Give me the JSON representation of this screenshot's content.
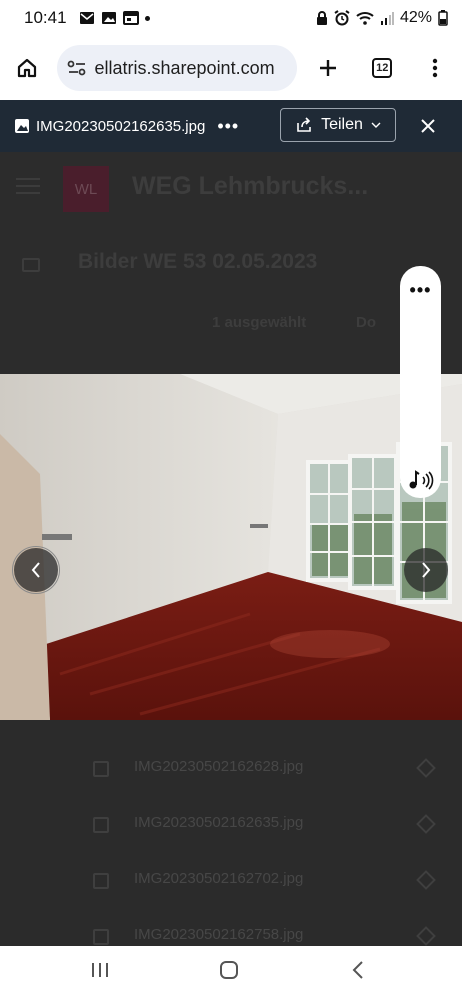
{
  "status_bar": {
    "time": "10:41",
    "left_icons": [
      "mail-icon",
      "image-icon",
      "calendar-icon",
      "notification-dot"
    ],
    "right_icons": [
      "lock-icon",
      "alarm-icon",
      "wifi-icon",
      "signal-icon",
      "battery-icon"
    ],
    "battery": "42%"
  },
  "browser": {
    "url": "ellatris.sharepoint.com",
    "tab_count": "12"
  },
  "viewer": {
    "file_name": "IMG20230502162635.jpg",
    "more_label": "•••",
    "share_label": "Teilen",
    "colors": {
      "header_bg": "#1f2a36"
    }
  },
  "sharepoint": {
    "site_logo": "WL",
    "site_title": "WEG Lehmbrucks...",
    "breadcrumb": "Bilder WE 53 02.05.2023",
    "selection": "1 ausgewählt",
    "download_label": "Do"
  },
  "files": [
    {
      "name": "IMG20230502162628.jpg"
    },
    {
      "name": "IMG20230502162635.jpg"
    },
    {
      "name": "IMG20230502162702.jpg"
    },
    {
      "name": "IMG20230502162758.jpg"
    }
  ]
}
